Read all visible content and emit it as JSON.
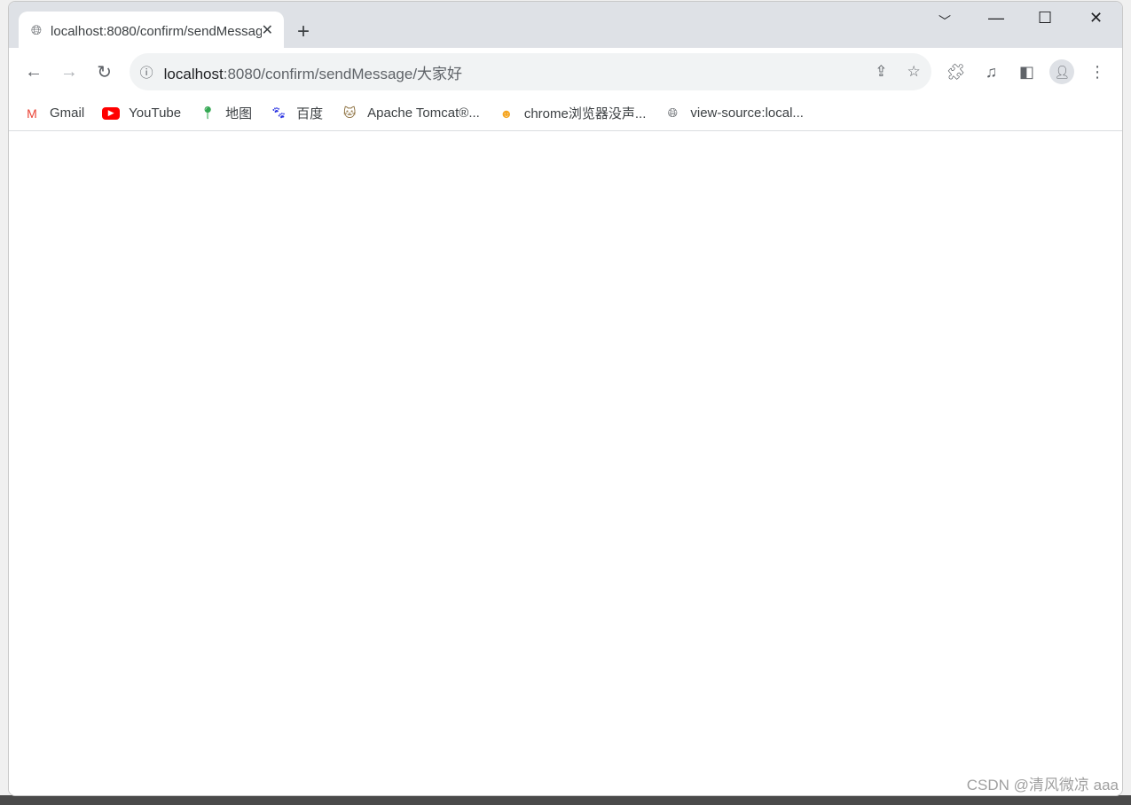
{
  "tab": {
    "title": "localhost:8080/confirm/sendMessage/大家好",
    "icon": "globe-icon"
  },
  "omnibox": {
    "host": "localhost",
    "rest": ":8080/confirm/sendMessage/大家好"
  },
  "bookmarks": [
    {
      "label": "Gmail",
      "icon": "gmail-icon",
      "color": "#ea4335"
    },
    {
      "label": "YouTube",
      "icon": "youtube-icon",
      "color": "#ff0000"
    },
    {
      "label": "地图",
      "icon": "maps-icon",
      "color": "#34a853"
    },
    {
      "label": "百度",
      "icon": "baidu-icon",
      "color": "#2932e1"
    },
    {
      "label": "Apache Tomcat®...",
      "icon": "tomcat-icon",
      "color": "#8a6d3b"
    },
    {
      "label": "chrome浏览器没声...",
      "icon": "smiley-icon",
      "color": "#f5a623"
    },
    {
      "label": "view-source:local...",
      "icon": "globe-icon",
      "color": "#5f6368"
    }
  ],
  "watermark": "CSDN @清风微凉 aaa"
}
